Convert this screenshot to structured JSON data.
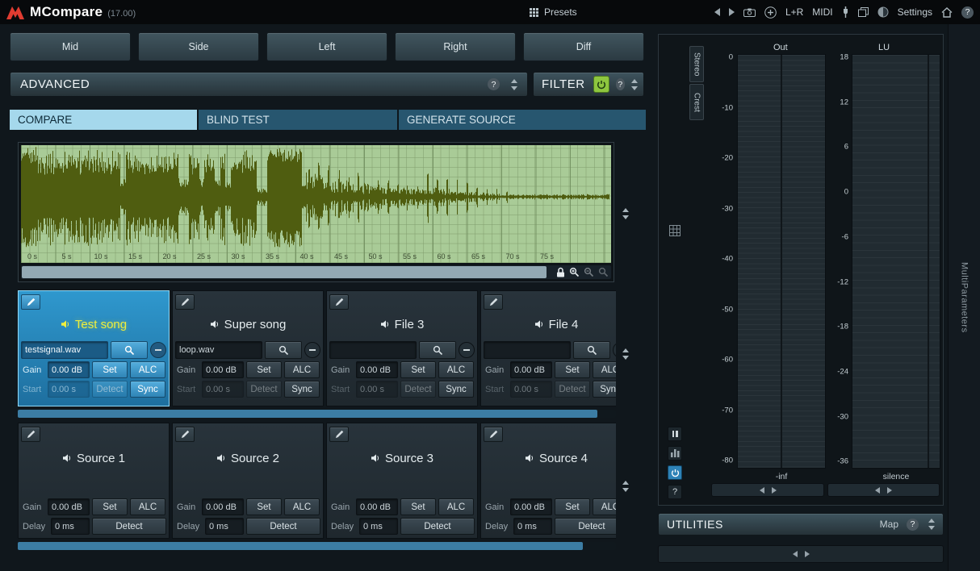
{
  "titlebar": {
    "app": "MCompare",
    "version": "(17.00)",
    "presets": "Presets",
    "channel_mode": "L+R",
    "midi": "MIDI",
    "settings": "Settings"
  },
  "ui": {
    "help_glyph": "?"
  },
  "channel_buttons": [
    "Mid",
    "Side",
    "Left",
    "Right",
    "Diff"
  ],
  "panels": {
    "advanced": "ADVANCED",
    "filter": "FILTER",
    "utilities": "UTILITIES",
    "map": "Map",
    "multiparameters": "MultiParameters"
  },
  "tabs": [
    "COMPARE",
    "BLIND TEST",
    "GENERATE SOURCE"
  ],
  "waveform": {
    "time_labels": [
      "0 s",
      "5 s",
      "10 s",
      "15 s",
      "20 s",
      "25 s",
      "30 s",
      "35 s",
      "40 s",
      "45 s",
      "50 s",
      "55 s",
      "60 s",
      "65 s",
      "70 s",
      "75 s"
    ]
  },
  "labels": {
    "gain": "Gain",
    "set": "Set",
    "alc": "ALC",
    "start": "Start",
    "detect": "Detect",
    "sync": "Sync",
    "delay": "Delay"
  },
  "files": [
    {
      "title": "Test song",
      "filename": "testsignal.wav",
      "gain": "0.00 dB",
      "start": "0.00 s"
    },
    {
      "title": "Super song",
      "filename": "loop.wav",
      "gain": "0.00 dB",
      "start": "0.00 s"
    },
    {
      "title": "File 3",
      "filename": "",
      "gain": "0.00 dB",
      "start": "0.00 s"
    },
    {
      "title": "File 4",
      "filename": "",
      "gain": "0.00 dB",
      "start": "0.00 s"
    }
  ],
  "sources": [
    {
      "title": "Source 1",
      "gain": "0.00 dB",
      "delay": "0 ms"
    },
    {
      "title": "Source 2",
      "gain": "0.00 dB",
      "delay": "0 ms"
    },
    {
      "title": "Source 3",
      "gain": "0.00 dB",
      "delay": "0 ms"
    },
    {
      "title": "Source 4",
      "gain": "0.00 dB",
      "delay": "0 ms"
    }
  ],
  "meters": {
    "out": {
      "label": "Out",
      "ticks": [
        "0",
        "-10",
        "-20",
        "-30",
        "-40",
        "-50",
        "-60",
        "-70",
        "-80"
      ],
      "floor": "-inf"
    },
    "lu": {
      "label": "LU",
      "ticks": [
        "18",
        "12",
        "6",
        "0",
        "-6",
        "-12",
        "-18",
        "-24",
        "-30",
        "-36"
      ],
      "floor": "silence"
    },
    "stereo_tab": "Stereo",
    "crest_tab": "Crest"
  },
  "colors": {
    "accent_selected": "#2f97cd",
    "tab_active": "#a5d8ec",
    "power_on_green": "#8ec63f",
    "waveform_bg": "#a9cb97",
    "waveform_ink": "#4f5d10",
    "scrollbar_blue": "#3c7da4",
    "selected_title_yellow": "#eeee3e"
  }
}
